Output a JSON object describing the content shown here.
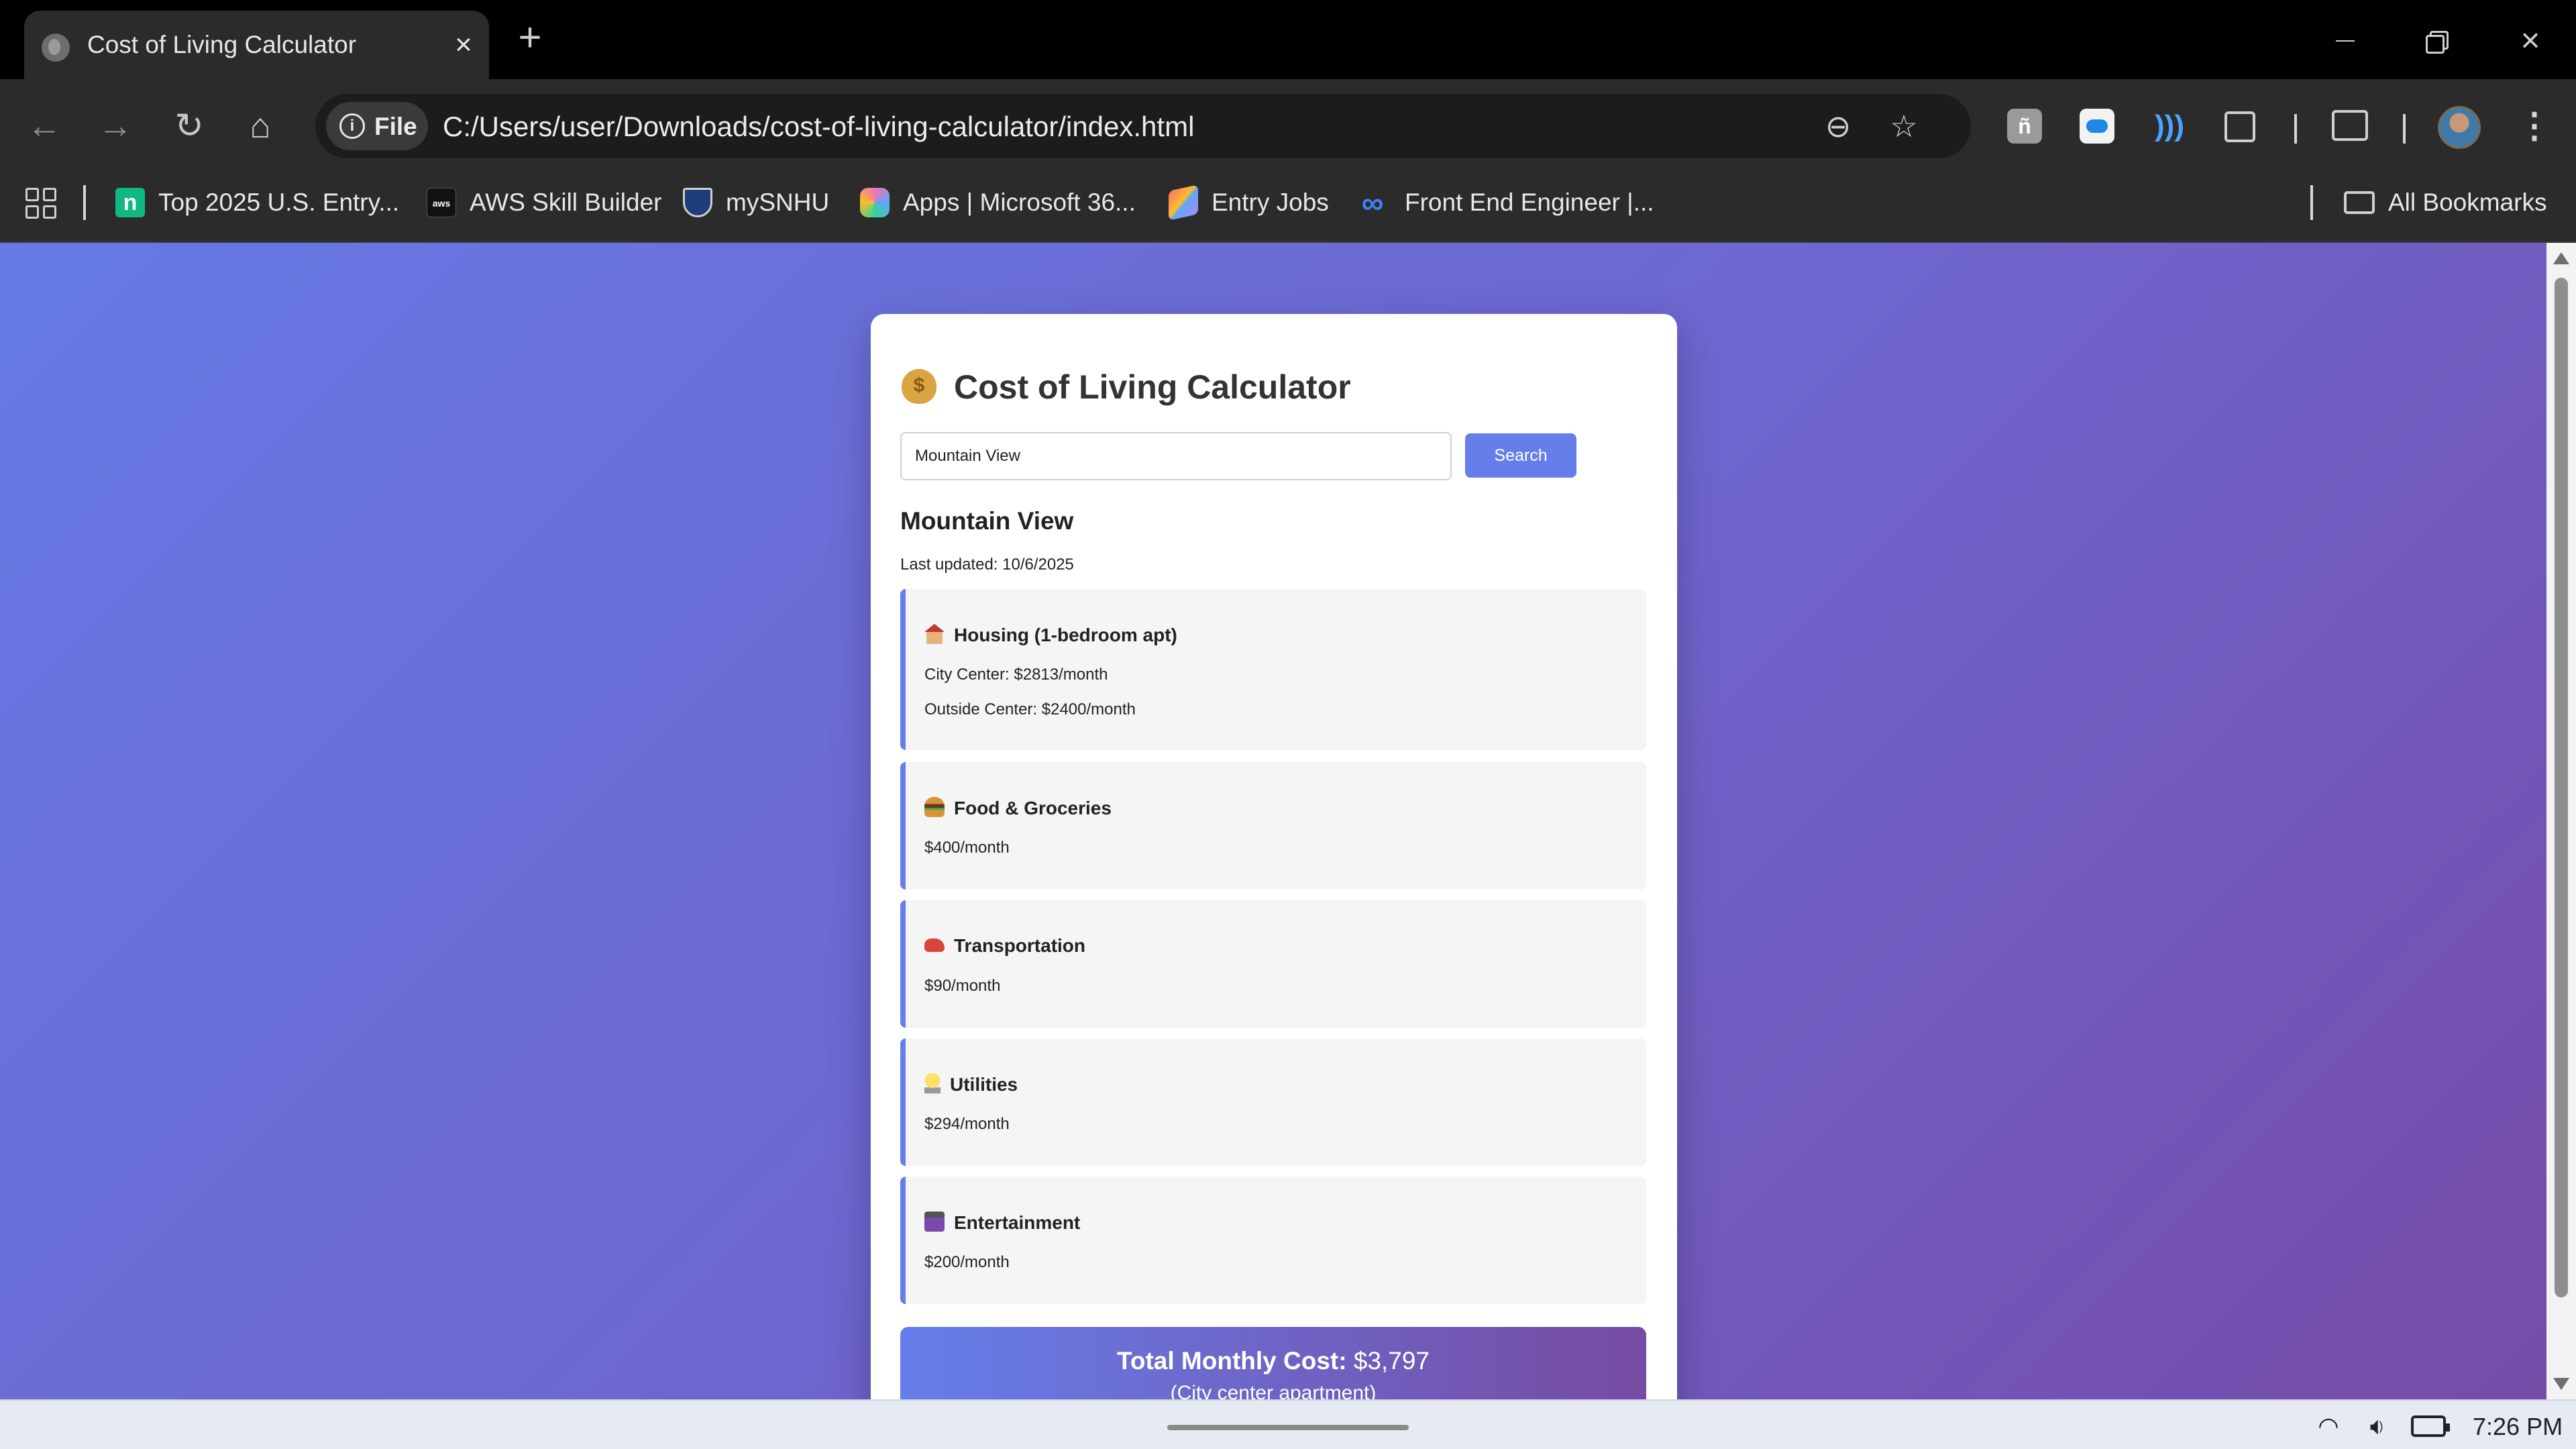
{
  "browser": {
    "tab_title": "Cost of Living Calculator",
    "url_chip": "File",
    "url": "C:/Users/user/Downloads/cost-of-living-calculator/index.html",
    "bookmarks": [
      {
        "label": "Top 2025 U.S. Entry...",
        "icon": "n"
      },
      {
        "label": "AWS Skill Builder",
        "icon": "aws"
      },
      {
        "label": "mySNHU",
        "icon": ""
      },
      {
        "label": "Apps | Microsoft 36...",
        "icon": ""
      },
      {
        "label": "Entry Jobs",
        "icon": ""
      },
      {
        "label": "Front End Engineer |...",
        "icon": "∞"
      }
    ],
    "all_bookmarks": "All Bookmarks"
  },
  "app": {
    "title": "Cost of Living Calculator",
    "search": {
      "value": "Mountain View",
      "button": "Search"
    },
    "city": "Mountain View",
    "last_updated": "Last updated: 10/6/2025",
    "categories": [
      {
        "title": "Housing (1-bedroom apt)",
        "icon": "house-icon",
        "lines": [
          "City Center: $2813/month",
          "Outside Center: $2400/month"
        ]
      },
      {
        "title": "Food & Groceries",
        "icon": "burger-icon",
        "lines": [
          "$400/month"
        ]
      },
      {
        "title": "Transportation",
        "icon": "car-icon",
        "lines": [
          "$90/month"
        ]
      },
      {
        "title": "Utilities",
        "icon": "lightbulb-icon",
        "lines": [
          "$294/month"
        ]
      },
      {
        "title": "Entertainment",
        "icon": "clapperboard-icon",
        "lines": [
          "$200/month"
        ]
      }
    ],
    "total": {
      "label": "Total Monthly Cost:",
      "value": "$3,797",
      "note": "(City center apartment)"
    }
  },
  "taskbar": {
    "time": "7:26 PM"
  },
  "colors": {
    "accent": "#667eea",
    "gradient_end": "#764ba2"
  }
}
